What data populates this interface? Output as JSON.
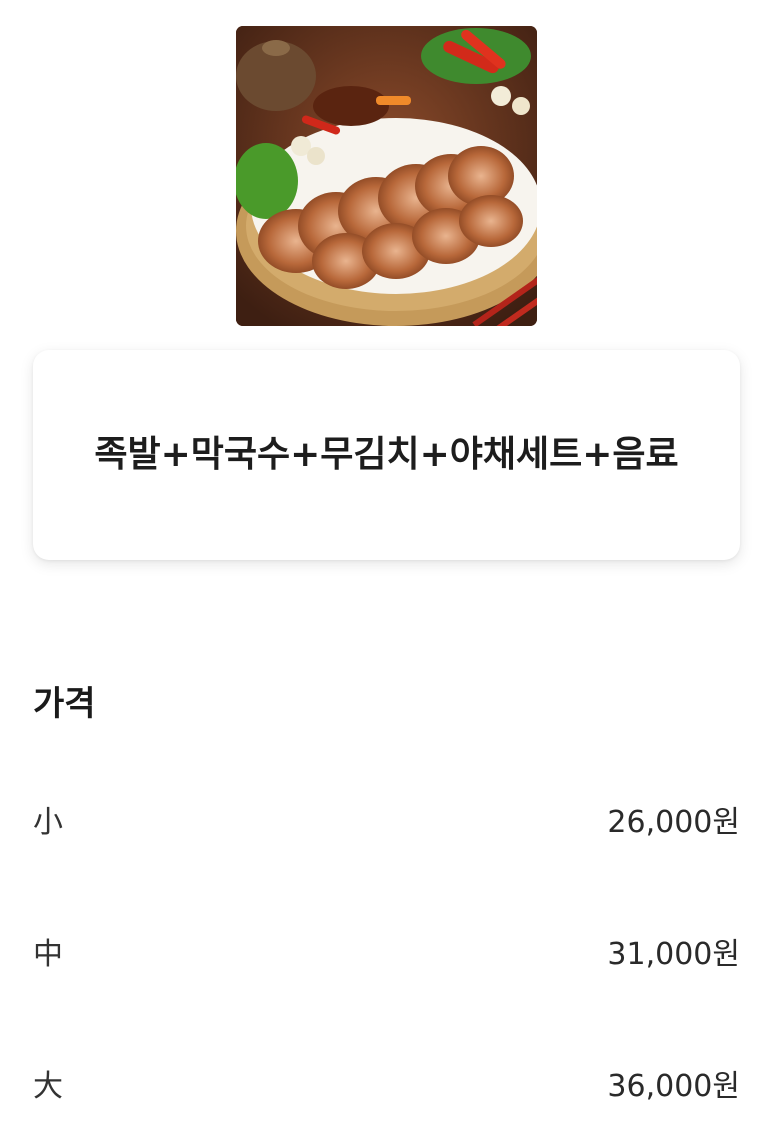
{
  "menu_item": {
    "image_icon": "food-photo",
    "title": "족발+막국수+무김치+야채세트+음료"
  },
  "price_section": {
    "heading": "가격",
    "options": [
      {
        "size": "小",
        "price": "26,000원"
      },
      {
        "size": "中",
        "price": "31,000원"
      },
      {
        "size": "大",
        "price": "36,000원"
      }
    ]
  }
}
